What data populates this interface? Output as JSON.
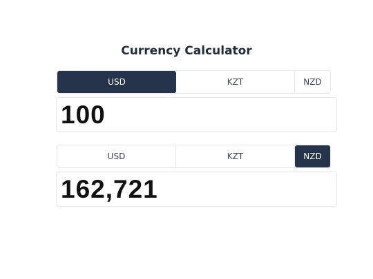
{
  "app": {
    "title": "Currency Calculator"
  },
  "from": {
    "tabs": [
      {
        "label": "USD",
        "active": true
      },
      {
        "label": "KZT",
        "active": false
      },
      {
        "label": "NZD",
        "active": false
      }
    ],
    "amount": "100"
  },
  "to": {
    "tabs": [
      {
        "label": "USD",
        "active": false
      },
      {
        "label": "KZT",
        "active": false
      },
      {
        "label": "NZD",
        "active": true
      }
    ],
    "amount": "162,721"
  },
  "colors": {
    "active_tab_bg": "#25344a",
    "active_tab_text": "#ffffff",
    "border": "#e3e6ea"
  }
}
